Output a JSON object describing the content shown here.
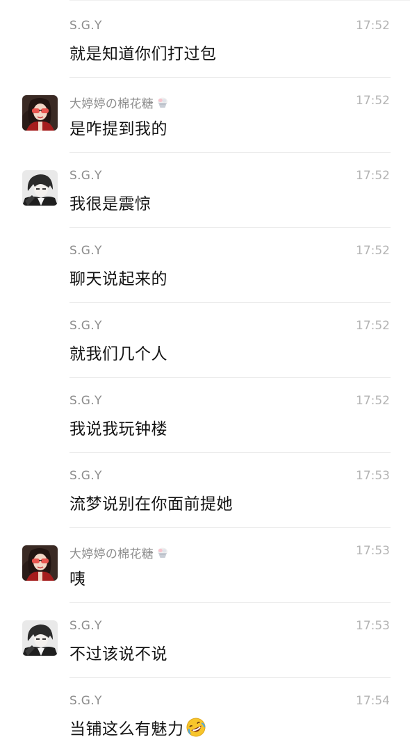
{
  "messages": [
    {
      "sender": "S.G.Y",
      "time": "17:52",
      "text": "就是知道你们打过包",
      "avatar": "none",
      "sender_badge": "none",
      "trailing_emoji": "none"
    },
    {
      "sender": "大婷婷の棉花糖",
      "time": "17:52",
      "text": "是咋提到我的",
      "avatar": "woman-red-glasses",
      "sender_badge": "shaved-ice-icon",
      "trailing_emoji": "none"
    },
    {
      "sender": "S.G.Y",
      "time": "17:52",
      "text": "我很是震惊",
      "avatar": "anime-boy",
      "sender_badge": "none",
      "trailing_emoji": "none"
    },
    {
      "sender": "S.G.Y",
      "time": "17:52",
      "text": "聊天说起来的",
      "avatar": "none",
      "sender_badge": "none",
      "trailing_emoji": "none"
    },
    {
      "sender": "S.G.Y",
      "time": "17:52",
      "text": "就我们几个人",
      "avatar": "none",
      "sender_badge": "none",
      "trailing_emoji": "none"
    },
    {
      "sender": "S.G.Y",
      "time": "17:52",
      "text": "我说我玩钟楼",
      "avatar": "none",
      "sender_badge": "none",
      "trailing_emoji": "none"
    },
    {
      "sender": "S.G.Y",
      "time": "17:53",
      "text": "流梦说别在你面前提她",
      "avatar": "none",
      "sender_badge": "none",
      "trailing_emoji": "none"
    },
    {
      "sender": "大婷婷の棉花糖",
      "time": "17:53",
      "text": "咦",
      "avatar": "woman-red-glasses",
      "sender_badge": "shaved-ice-icon",
      "trailing_emoji": "none"
    },
    {
      "sender": "S.G.Y",
      "time": "17:53",
      "text": "不过该说不说",
      "avatar": "anime-boy",
      "sender_badge": "none",
      "trailing_emoji": "none"
    },
    {
      "sender": "S.G.Y",
      "time": "17:54",
      "text": "当铺这么有魅力",
      "avatar": "none",
      "sender_badge": "none",
      "trailing_emoji": "rolling-laughing-emoji"
    }
  ]
}
